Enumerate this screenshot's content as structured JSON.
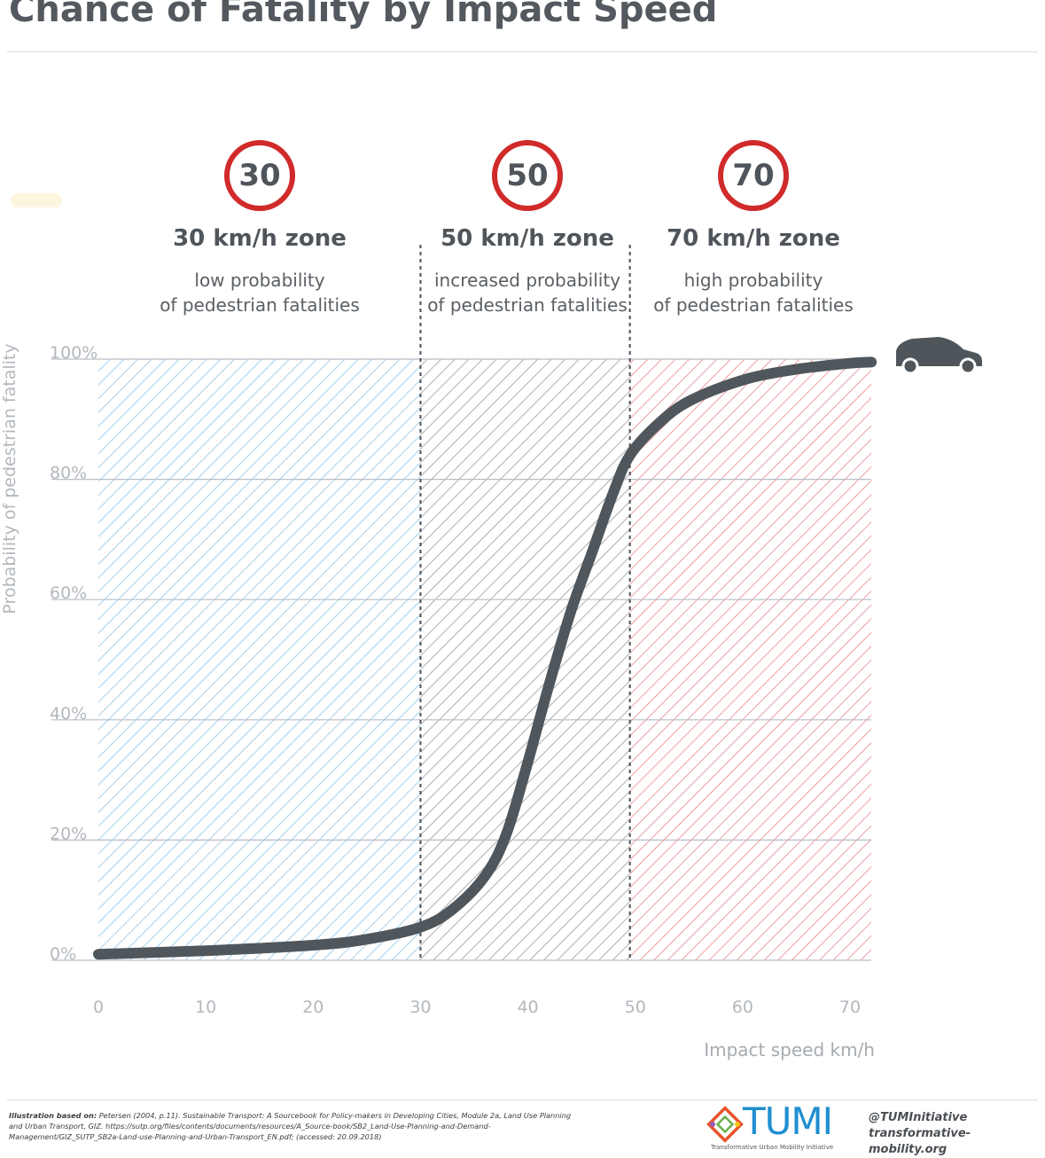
{
  "header": {
    "title": "Chance of Fatality by Impact Speed"
  },
  "zones": [
    {
      "sign": "30",
      "title": "30 km/h zone",
      "desc_line1": "low probability",
      "desc_line2": "of pedestrian fatalities"
    },
    {
      "sign": "50",
      "title": "50 km/h zone",
      "desc_line1": "increased probability",
      "desc_line2": "of pedestrian fatalities"
    },
    {
      "sign": "70",
      "title": "70 km/h zone",
      "desc_line1": "high probability",
      "desc_line2": "of pedestrian fatalities"
    }
  ],
  "chart_data": {
    "type": "line",
    "title": "Chance of Fatality by Impact Speed",
    "xlabel": "Impact speed km/h",
    "ylabel": "Probability of pedestrian fatality",
    "xlim": [
      0,
      72
    ],
    "ylim": [
      0,
      100
    ],
    "x_ticks": [
      "0",
      "10",
      "20",
      "30",
      "40",
      "50",
      "60",
      "70"
    ],
    "y_ticks": [
      "0%",
      "20%",
      "40%",
      "60%",
      "80%",
      "100%"
    ],
    "grid": "horizontal",
    "zones": [
      {
        "from": 0,
        "to": 30,
        "color": "#8fc3e6"
      },
      {
        "from": 30,
        "to": 49.5,
        "color": "#9a9a9a"
      },
      {
        "from": 49.5,
        "to": 72,
        "color": "#e8868a"
      }
    ],
    "series": [
      {
        "color": "#50575c",
        "points": [
          [
            0,
            1
          ],
          [
            10,
            1.6
          ],
          [
            20,
            2.5
          ],
          [
            25,
            3.5
          ],
          [
            30,
            5.5
          ],
          [
            33,
            8.5
          ],
          [
            36,
            14
          ],
          [
            38,
            21
          ],
          [
            40,
            33
          ],
          [
            42,
            46
          ],
          [
            44,
            58
          ],
          [
            46,
            68
          ],
          [
            48,
            78
          ],
          [
            49.5,
            84
          ],
          [
            52,
            89
          ],
          [
            55,
            93
          ],
          [
            60,
            96.5
          ],
          [
            65,
            98.3
          ],
          [
            70,
            99.3
          ],
          [
            72,
            99.5
          ]
        ]
      }
    ],
    "line_color": "#50575c",
    "icon": "car-icon"
  },
  "footer": {
    "source_label": "Illustration based on:",
    "source_text": "Petersen (2004, p.11). Sustainable Transport: A Sourcebook for Policy-makers in Developing Cities, Module 2a, Land Use Planning and Urban Transport, GIZ. https://sutp.org/files/contents/documents/resources/A_Source-book/SB2_Land-Use-Planning-and-Demand-Management/GIZ_SUTP_SB2a-Land-use-Planning-and-Urban-Transport_EN.pdf; (accessed: 20.09.2018)",
    "logo_text": "TUMI",
    "logo_subtext": "Transformative Urban Mobility Initiative",
    "handle": "@TUMInitiative",
    "website": "transformative-mobility.org"
  },
  "colors": {
    "sign_border": "#d12a2a",
    "brand": "#1f8fd0",
    "text": "#4f555a"
  }
}
